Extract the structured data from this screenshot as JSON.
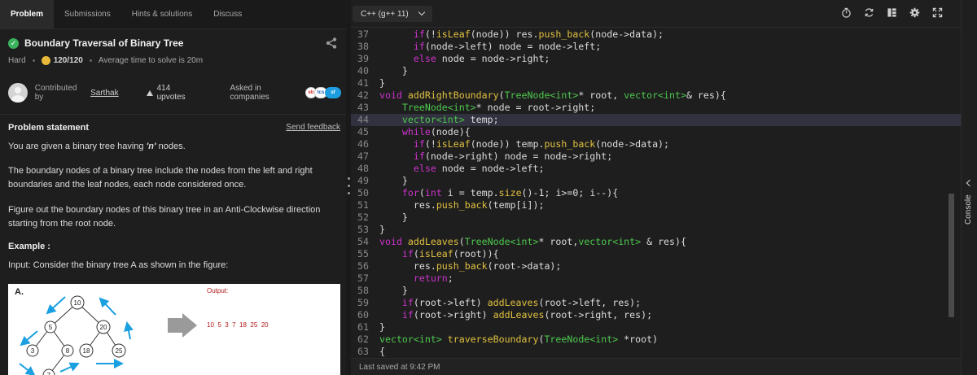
{
  "tabs": [
    {
      "label": "Problem",
      "active": true
    },
    {
      "label": "Submissions"
    },
    {
      "label": "Hints & solutions"
    },
    {
      "label": "Discuss"
    }
  ],
  "problem": {
    "title": "Boundary Traversal of Binary Tree",
    "difficulty": "Hard",
    "score": "120/120",
    "avg_time": "Average time to solve is 20m",
    "contributed_prefix": "Contributed by",
    "contributor": "Sarthak",
    "upvotes": "414 upvotes",
    "asked_in": "Asked in companies",
    "company_logos": [
      "eBay",
      "TCS",
      "salesforce"
    ],
    "statement_heading": "Problem statement",
    "feedback_link": "Send feedback",
    "para1_pre": "You are given a binary tree having ",
    "para1_em": "'n'",
    "para1_post": " nodes.",
    "para2": "The boundary nodes of a binary tree include the nodes from the left and right boundaries and the leaf nodes, each node considered once.",
    "para3": "Figure out the boundary nodes of this binary tree in an Anti-Clockwise direction starting from the root node.",
    "example_heading": "Example :",
    "input_label": "Input:",
    "input_text": " Consider the binary tree A as shown in the figure:"
  },
  "figure": {
    "label": "A.",
    "output_label": "Output:",
    "output_values": "10  5  3  7  18  25  20",
    "nodes": [
      "10",
      "5",
      "20",
      "3",
      "8",
      "18",
      "25",
      "7"
    ]
  },
  "editor": {
    "language": "C++ (g++ 11)",
    "last_saved": "Last saved at 9:42 PM",
    "console_label": "Console",
    "icons": [
      "timer-icon",
      "refresh-icon",
      "layout-icon",
      "settings-icon",
      "fullscreen-icon"
    ],
    "highlighted_line": "44",
    "lines": [
      {
        "n": "37",
        "tokens": [
          [
            "kw",
            "      if"
          ],
          [
            "br",
            "(!"
          ],
          [
            "fn",
            "isLeaf"
          ],
          [
            "br",
            "(node)) res."
          ],
          [
            "fn",
            "push_back"
          ],
          [
            "br",
            "(node->data);"
          ]
        ]
      },
      {
        "n": "38",
        "tokens": [
          [
            "kw",
            "      if"
          ],
          [
            "br",
            "(node->left) node = node->left;"
          ]
        ]
      },
      {
        "n": "39",
        "tokens": [
          [
            "kw",
            "      else"
          ],
          [
            "br",
            " node = node->right;"
          ]
        ]
      },
      {
        "n": "40",
        "tokens": [
          [
            "br",
            "    }"
          ]
        ]
      },
      {
        "n": "41",
        "tokens": [
          [
            "br",
            "}"
          ]
        ]
      },
      {
        "n": "42",
        "tokens": [
          [
            "kw",
            "void"
          ],
          [
            "br",
            " "
          ],
          [
            "fn",
            "addRightBoundary"
          ],
          [
            "br",
            "("
          ],
          [
            "ty",
            "TreeNode<int>"
          ],
          [
            "br",
            "* root, "
          ],
          [
            "ty",
            "vector<int>"
          ],
          [
            "br",
            "& res){"
          ]
        ]
      },
      {
        "n": "43",
        "tokens": [
          [
            "ty",
            "    TreeNode<int>"
          ],
          [
            "br",
            "* node = root->right;"
          ]
        ]
      },
      {
        "n": "44",
        "tokens": [
          [
            "ty",
            "    vector<int>"
          ],
          [
            "br",
            " temp;"
          ]
        ]
      },
      {
        "n": "45",
        "tokens": [
          [
            "kw",
            "    while"
          ],
          [
            "br",
            "(node){"
          ]
        ]
      },
      {
        "n": "46",
        "tokens": [
          [
            "kw",
            "      if"
          ],
          [
            "br",
            "(!"
          ],
          [
            "fn",
            "isLeaf"
          ],
          [
            "br",
            "(node)) temp."
          ],
          [
            "fn",
            "push_back"
          ],
          [
            "br",
            "(node->data);"
          ]
        ]
      },
      {
        "n": "47",
        "tokens": [
          [
            "kw",
            "      if"
          ],
          [
            "br",
            "(node->right) node = node->right;"
          ]
        ]
      },
      {
        "n": "48",
        "tokens": [
          [
            "kw",
            "      else"
          ],
          [
            "br",
            " node = node->left;"
          ]
        ]
      },
      {
        "n": "49",
        "tokens": [
          [
            "br",
            "    }"
          ]
        ]
      },
      {
        "n": "50",
        "tokens": [
          [
            "kw",
            "    for"
          ],
          [
            "br",
            "("
          ],
          [
            "kw",
            "int"
          ],
          [
            "br",
            " i = temp."
          ],
          [
            "fn",
            "size"
          ],
          [
            "br",
            "()-"
          ],
          [
            "nm",
            "1"
          ],
          [
            "br",
            "; i>="
          ],
          [
            "nm",
            "0"
          ],
          [
            "br",
            "; i--){"
          ]
        ]
      },
      {
        "n": "51",
        "tokens": [
          [
            "br",
            "      res."
          ],
          [
            "fn",
            "push_back"
          ],
          [
            "br",
            "(temp[i]);"
          ]
        ]
      },
      {
        "n": "52",
        "tokens": [
          [
            "br",
            "    }"
          ]
        ]
      },
      {
        "n": "53",
        "tokens": [
          [
            "br",
            "}"
          ]
        ]
      },
      {
        "n": "54",
        "tokens": [
          [
            "kw",
            "void"
          ],
          [
            "br",
            " "
          ],
          [
            "fn",
            "addLeaves"
          ],
          [
            "br",
            "("
          ],
          [
            "ty",
            "TreeNode<int>"
          ],
          [
            "br",
            "* root,"
          ],
          [
            "ty",
            "vector<int>"
          ],
          [
            "br",
            " & res){"
          ]
        ]
      },
      {
        "n": "55",
        "tokens": [
          [
            "kw",
            "    if"
          ],
          [
            "br",
            "("
          ],
          [
            "fn",
            "isLeaf"
          ],
          [
            "br",
            "(root)){"
          ]
        ]
      },
      {
        "n": "56",
        "tokens": [
          [
            "br",
            "      res."
          ],
          [
            "fn",
            "push_back"
          ],
          [
            "br",
            "(root->data);"
          ]
        ]
      },
      {
        "n": "57",
        "tokens": [
          [
            "kw",
            "      return"
          ],
          [
            "br",
            ";"
          ]
        ]
      },
      {
        "n": "58",
        "tokens": [
          [
            "br",
            "    }"
          ]
        ]
      },
      {
        "n": "59",
        "tokens": [
          [
            "kw",
            "    if"
          ],
          [
            "br",
            "(root->left) "
          ],
          [
            "fn",
            "addLeaves"
          ],
          [
            "br",
            "(root->left, res);"
          ]
        ]
      },
      {
        "n": "60",
        "tokens": [
          [
            "kw",
            "    if"
          ],
          [
            "br",
            "(root->right) "
          ],
          [
            "fn",
            "addLeaves"
          ],
          [
            "br",
            "(root->right, res);"
          ]
        ]
      },
      {
        "n": "61",
        "tokens": [
          [
            "br",
            "}"
          ]
        ]
      },
      {
        "n": "62",
        "tokens": [
          [
            "ty",
            "vector<int>"
          ],
          [
            "br",
            " "
          ],
          [
            "fn",
            "traverseBoundary"
          ],
          [
            "br",
            "("
          ],
          [
            "ty",
            "TreeNode<int>"
          ],
          [
            "br",
            " *root)"
          ]
        ]
      },
      {
        "n": "63",
        "tokens": [
          [
            "br",
            "{"
          ]
        ]
      }
    ]
  }
}
